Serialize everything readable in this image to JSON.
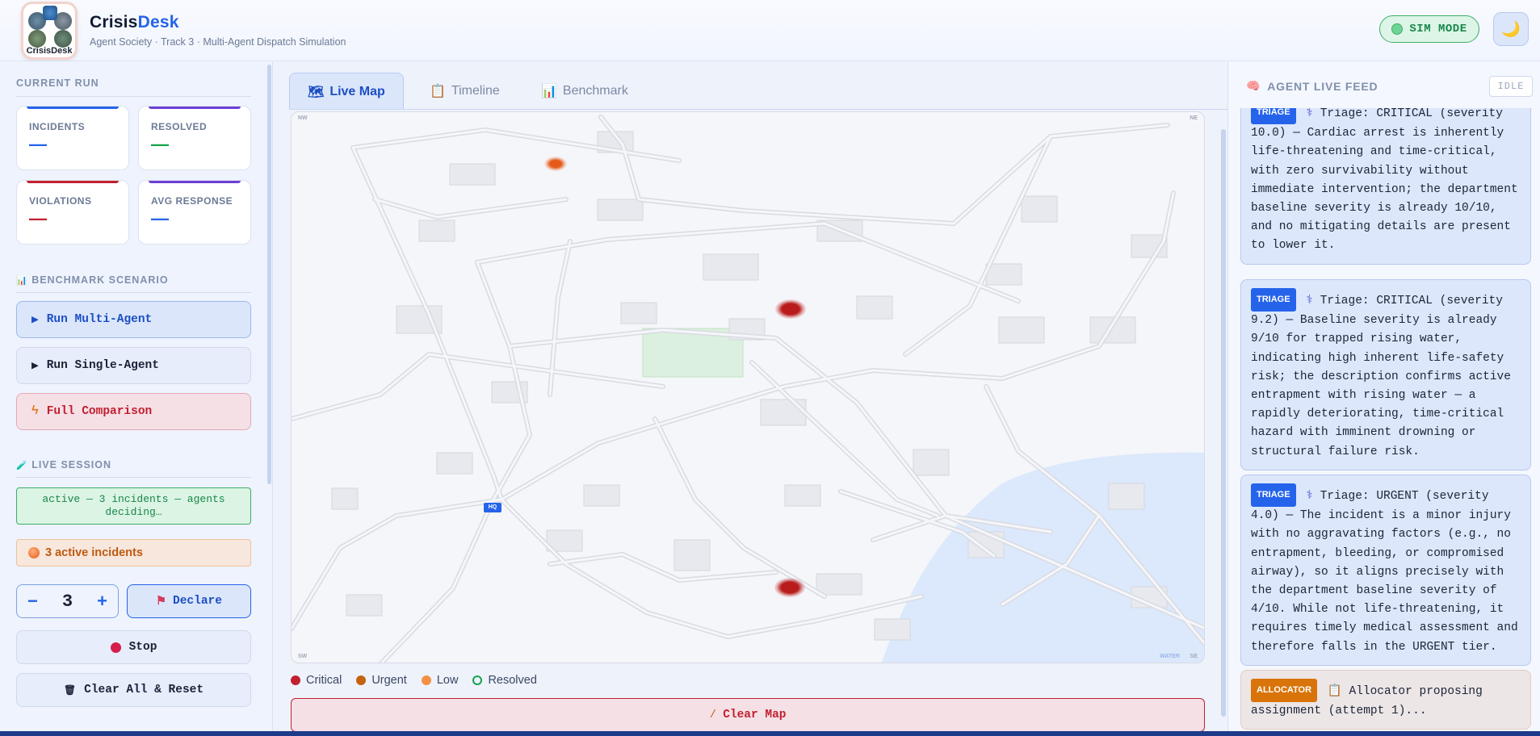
{
  "header": {
    "logo_text": "CrisisDesk",
    "brand_main": "Crisis",
    "brand_accent": "Desk",
    "subtitle": "Agent Society · Track 3 · Multi-Agent Dispatch Simulation",
    "sim_mode": "SIM MODE",
    "theme_icon": "🌙"
  },
  "sidebar": {
    "current_run_title": "CURRENT RUN",
    "stats": [
      {
        "label": "INCIDENTS",
        "value": "—",
        "color": "#2563eb"
      },
      {
        "label": "RESOLVED",
        "value": "—",
        "color": "#16a34a"
      },
      {
        "label": "VIOLATIONS",
        "value": "—",
        "color": "#c2202f"
      },
      {
        "label": "AVG RESPONSE",
        "value": "—",
        "color": "#2563eb"
      }
    ],
    "benchmark_title": "BENCHMARK SCENARIO",
    "benchmark_icon": "📊",
    "run_multi": "Run Multi-Agent",
    "run_single": "Run Single-Agent",
    "full_comparison": "Full Comparison",
    "live_title": "LIVE SESSION",
    "live_icon": "🧪",
    "session_status": "active — 3 incidents — agents deciding…",
    "active_incidents": "3 active incidents",
    "stepper_value": "3",
    "stepper_minus": "−",
    "stepper_plus": "+",
    "declare": "Declare",
    "stop": "Stop",
    "clear_reset": "Clear All & Reset"
  },
  "tabs": [
    {
      "label": "Live Map",
      "icon": "🗺"
    },
    {
      "label": "Timeline",
      "icon": "📋"
    },
    {
      "label": "Benchmark",
      "icon": "📊"
    }
  ],
  "map": {
    "corners": {
      "nw": "NW",
      "ne": "NE",
      "sw": "SW",
      "se": "SE",
      "water": "WATER"
    },
    "hq": "HQ"
  },
  "legend": [
    {
      "label": "Critical",
      "color": "#c2202f"
    },
    {
      "label": "Urgent",
      "color": "#c4620f"
    },
    {
      "label": "Low",
      "color": "#f59043"
    },
    {
      "label": "Resolved",
      "color": "#16a34a"
    }
  ],
  "clear_map": "Clear Map",
  "feed": {
    "title": "AGENT LIVE FEED",
    "status": "IDLE",
    "cards": [
      {
        "tag": "TRIAGE",
        "text": "Triage: CRITICAL (severity 10.0) — Cardiac arrest is inherently life-threatening and time-critical, with zero survivability without immediate intervention; the department baseline severity is already 10/10, and no mitigating details are present to lower it."
      },
      {
        "tag": "TRIAGE",
        "text": "Triage: CRITICAL (severity 9.2) — Baseline severity is already 9/10 for trapped rising water, indicating high inherent life-safety risk; the description confirms active entrapment with rising water — a rapidly deteriorating, time-critical hazard with imminent drowning or structural failure risk."
      },
      {
        "tag": "TRIAGE",
        "text": "Triage: URGENT (severity 4.0) — The incident is a minor injury with no aggravating factors (e.g., no entrapment, bleeding, or compromised airway), so it aligns precisely with the department baseline severity of 4/10. While not life-threatening, it requires timely medical assessment and therefore falls in the URGENT tier."
      },
      {
        "tag": "ALLOCATOR",
        "text": "Allocator proposing assignment (attempt 1)..."
      }
    ]
  }
}
